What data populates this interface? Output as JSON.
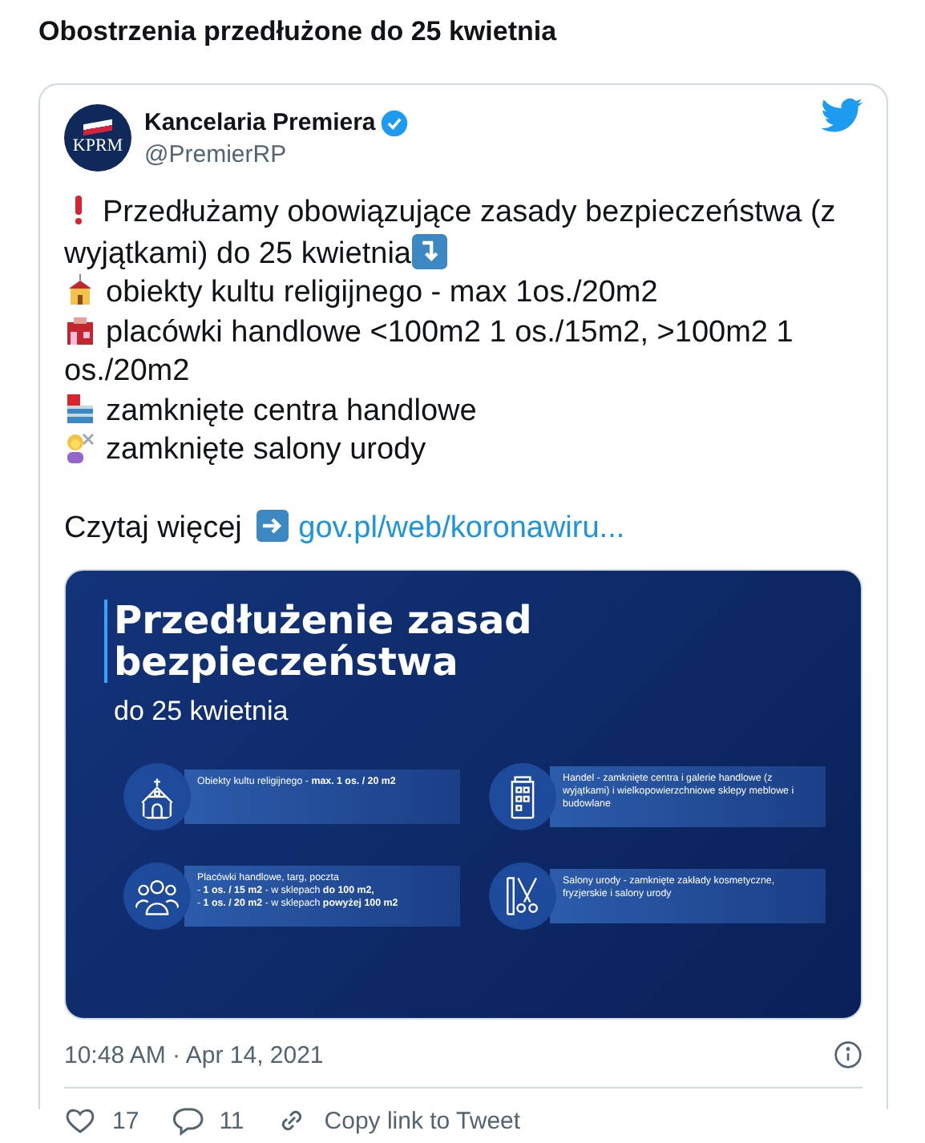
{
  "headline": "Obostrzenia przedłużone do 25 kwietnia",
  "tweet": {
    "author": {
      "name": "Kancelaria Premiera",
      "handle": "@PremierRP",
      "avatar_text": "KPRM",
      "verified": true
    },
    "lines": [
      {
        "kind": "exclamation",
        "text": "Przedłużamy obowiązujące zasady bezpieczeństwa (z wyjątkami) do 25 kwietnia",
        "trailing_icon": true
      },
      {
        "kind": "church",
        "text": "obiekty kultu religijnego - max 1os./20m2"
      },
      {
        "kind": "shop",
        "text": "placówki handlowe <100m2 1 os./15m2, >100m2 1 os./20m2"
      },
      {
        "kind": "mall",
        "text": "zamknięte centra handlowe"
      },
      {
        "kind": "salon",
        "text": "zamknięte salony urody"
      }
    ],
    "more": {
      "text": "Czytaj więcej",
      "link": "gov.pl/web/koronawiru..."
    },
    "infographic": {
      "title": "Przedłużenie zasad bezpieczeństwa",
      "subtitle": "do 25 kwietnia",
      "items": [
        {
          "kind": "church",
          "lines": [
            "Obiekty kultu religijnego - **max. 1 os. / 20 m2**"
          ]
        },
        {
          "kind": "building",
          "lines": [
            "Handel - zamknięte centra i galerie handlowe (z wyjątkami) i wielkopowierzchniowe sklepy meblowe i budowlane"
          ]
        },
        {
          "kind": "people",
          "lines": [
            "Placówki handlowe, targ, poczta",
            "- **1 os. / 15 m2** - w sklepach **do 100 m2,**",
            "- **1 os. / 20 m2** - w sklepach **powyżej 100 m2**"
          ]
        },
        {
          "kind": "scissors",
          "lines": [
            "Salony urody - zamknięte zakłady kosmetyczne, fryzjerskie i salony urody"
          ]
        }
      ]
    },
    "timestamp": "10:48 AM · Apr 14, 2021",
    "actions": [
      {
        "kind": "like",
        "label": "17"
      },
      {
        "kind": "reply",
        "label": "11"
      },
      {
        "kind": "link",
        "label": "Copy link to Tweet"
      }
    ]
  }
}
